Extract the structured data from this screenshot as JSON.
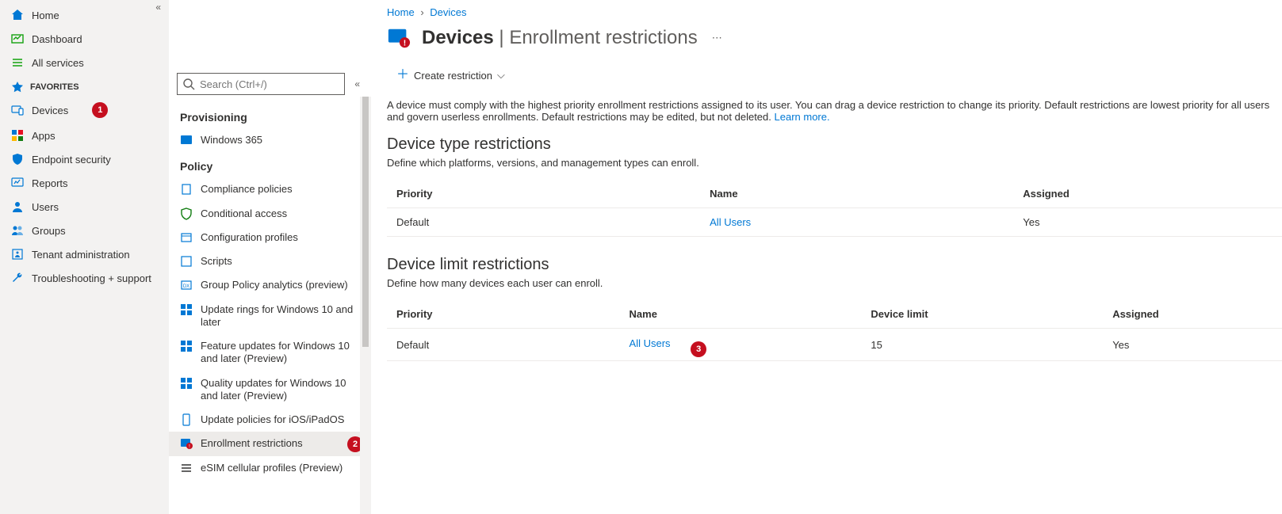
{
  "nav1": {
    "items": [
      {
        "id": "home",
        "label": "Home"
      },
      {
        "id": "dashboard",
        "label": "Dashboard"
      },
      {
        "id": "allservices",
        "label": "All services"
      }
    ],
    "favorites_heading": "FAVORITES",
    "favorites": [
      {
        "id": "devices",
        "label": "Devices",
        "badge": "1"
      },
      {
        "id": "apps",
        "label": "Apps"
      },
      {
        "id": "endpoint",
        "label": "Endpoint security"
      },
      {
        "id": "reports",
        "label": "Reports"
      },
      {
        "id": "users",
        "label": "Users"
      },
      {
        "id": "groups",
        "label": "Groups"
      },
      {
        "id": "tenant",
        "label": "Tenant administration"
      },
      {
        "id": "troubleshoot",
        "label": "Troubleshooting + support"
      }
    ]
  },
  "nav2": {
    "search_placeholder": "Search (Ctrl+/)",
    "sections": {
      "provisioning_heading": "Provisioning",
      "provisioning_items": [
        {
          "id": "w365",
          "label": "Windows 365"
        }
      ],
      "policy_heading": "Policy",
      "policy_items": [
        {
          "id": "compliance",
          "label": "Compliance policies"
        },
        {
          "id": "conditional",
          "label": "Conditional access"
        },
        {
          "id": "configprof",
          "label": "Configuration profiles"
        },
        {
          "id": "scripts",
          "label": "Scripts"
        },
        {
          "id": "gpa",
          "label": "Group Policy analytics (preview)"
        },
        {
          "id": "updaterings",
          "label": "Update rings for Windows 10 and later"
        },
        {
          "id": "featureupd",
          "label": "Feature updates for Windows 10 and later (Preview)"
        },
        {
          "id": "qualityupd",
          "label": "Quality updates for Windows 10 and later (Preview)"
        },
        {
          "id": "iosupd",
          "label": "Update policies for iOS/iPadOS"
        },
        {
          "id": "enroll",
          "label": "Enrollment restrictions",
          "selected": true,
          "badge": "2"
        },
        {
          "id": "esim",
          "label": "eSIM cellular profiles (Preview)"
        }
      ]
    }
  },
  "breadcrumb": {
    "home": "Home",
    "devices": "Devices"
  },
  "title": {
    "main": "Devices",
    "sub": "Enrollment restrictions"
  },
  "toolbar": {
    "create_label": "Create restriction"
  },
  "desc_text": "A device must comply with the highest priority enrollment restrictions assigned to its user. You can drag a device restriction to change its priority. Default restrictions are lowest priority for all users and govern userless enrollments. Default restrictions may be edited, but not deleted. ",
  "desc_link": "Learn more.",
  "type_restrictions": {
    "heading": "Device type restrictions",
    "sub": "Define which platforms, versions, and management types can enroll.",
    "cols": {
      "priority": "Priority",
      "name": "Name",
      "assigned": "Assigned"
    },
    "rows": [
      {
        "priority": "Default",
        "name": "All Users",
        "assigned": "Yes"
      }
    ]
  },
  "limit_restrictions": {
    "heading": "Device limit restrictions",
    "sub": "Define how many devices each user can enroll.",
    "cols": {
      "priority": "Priority",
      "name": "Name",
      "limit": "Device limit",
      "assigned": "Assigned"
    },
    "rows": [
      {
        "priority": "Default",
        "name": "All Users",
        "limit": "15",
        "assigned": "Yes",
        "badge": "3"
      }
    ]
  }
}
